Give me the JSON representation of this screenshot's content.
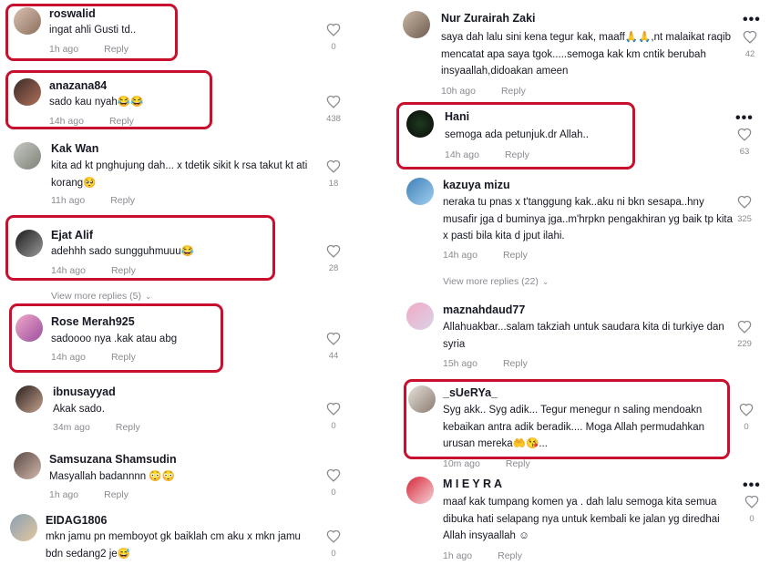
{
  "left": {
    "comments": [
      {
        "user": "roswalid",
        "text": "ingat ahli Gusti td..",
        "time": "1h ago",
        "reply": "Reply",
        "likes": "0"
      },
      {
        "user": "anazana84",
        "text": "sado kau nyah😂😂",
        "time": "14h ago",
        "reply": "Reply",
        "likes": "438"
      },
      {
        "user": "Kak Wan",
        "text": "kita ad kt pnghujung dah... x tdetik sikit k rsa takut kt ati korang🥺",
        "time": "11h ago",
        "reply": "Reply",
        "likes": "18"
      },
      {
        "user": "Ejat Alif",
        "text": "adehhh sado sungguhmuuu😂",
        "time": "14h ago",
        "reply": "Reply",
        "likes": "28"
      },
      {
        "user": "Rose Merah925",
        "text": "sadoooo nya .kak atau abg",
        "time": "14h ago",
        "reply": "Reply",
        "likes": "44"
      },
      {
        "user": "ibnusayyad",
        "text": "Akak sado.",
        "time": "34m ago",
        "reply": "Reply",
        "likes": "0"
      },
      {
        "user": "Samsuzana Shamsudin",
        "text": "Masyallah badannnn 😳😳",
        "time": "1h ago",
        "reply": "Reply",
        "likes": "0"
      },
      {
        "user": "EIDAG1806",
        "text": "mkn jamu pn memboyot gk baiklah cm aku x mkn jamu bdn sedang2 je😅",
        "time": "1h ago",
        "reply": "Reply",
        "likes": "0"
      }
    ],
    "view_more": "View more replies (5)"
  },
  "right": {
    "comments": [
      {
        "user": "Nur Zurairah Zaki",
        "text": "saya dah lalu sini kena tegur kak, maaff🙏🙏,nt malaikat raqib mencatat apa saya tgok.....semoga kak km cntik berubah insyaallah,didoakan ameen",
        "time": "10h ago",
        "reply": "Reply",
        "likes": "42"
      },
      {
        "user": "Hani",
        "text": "semoga ada petunjuk.dr Allah..",
        "time": "14h ago",
        "reply": "Reply",
        "likes": "63"
      },
      {
        "user": "kazuya mizu",
        "text": "neraka tu pnas x t'tanggung kak..aku ni bkn sesapa..hny musafir jga d buminya jga..m'hrpkn pengakhiran yg baik tp kita x pasti bila kita d jput ilahi.",
        "time": "14h ago",
        "reply": "Reply",
        "likes": "325"
      },
      {
        "user": "maznahdaud77",
        "text": "Allahuakbar...salam takziah untuk saudara kita di turkiye dan syria",
        "time": "15h ago",
        "reply": "Reply",
        "likes": "229"
      },
      {
        "user": "_sUeRYa_",
        "text": "Syg akk.. Syg adik... Tegur menegur n saling mendoakn kebaikan antra adik beradik.... Moga Allah permudahkan urusan mereka🤲😘...",
        "time": "10m ago",
        "reply": "Reply",
        "likes": "0"
      },
      {
        "user": "M I E Y R A",
        "text": "maaf kak tumpang komen ya . dah lalu semoga kita semua dibuka hati selapang nya untuk kembali ke jalan yg diredhai Allah insyaallah ☺",
        "time": "1h ago",
        "reply": "Reply",
        "likes": "0"
      }
    ],
    "view_more": "View more replies (22)",
    "more_icon": "•••"
  },
  "colors": {
    "highlight": "#c8102e",
    "muted": "#8a8b91",
    "text": "#161823"
  }
}
